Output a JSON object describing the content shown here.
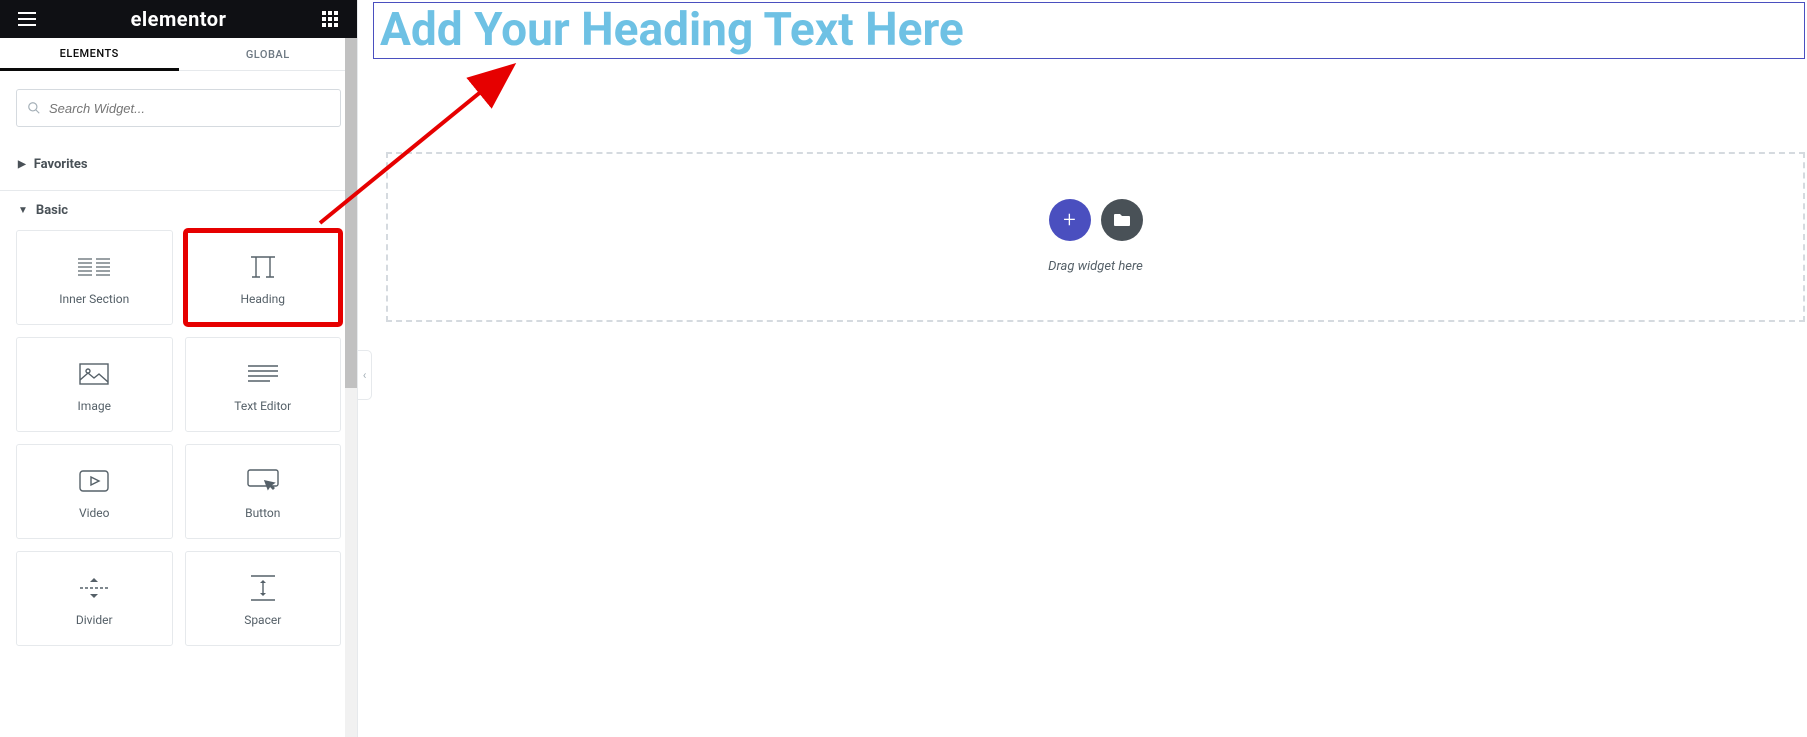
{
  "header": {
    "brand": "elementor"
  },
  "tabs": {
    "elements": "ELEMENTS",
    "global": "GLOBAL"
  },
  "search": {
    "placeholder": "Search Widget..."
  },
  "sections": {
    "favorites": "Favorites",
    "basic": "Basic"
  },
  "widgets": {
    "inner_section": "Inner Section",
    "heading": "Heading",
    "image": "Image",
    "text_editor": "Text Editor",
    "video": "Video",
    "button": "Button",
    "divider": "Divider",
    "spacer": "Spacer"
  },
  "canvas": {
    "heading_text": "Add Your Heading Text Here",
    "drop_hint": "Drag widget here"
  }
}
